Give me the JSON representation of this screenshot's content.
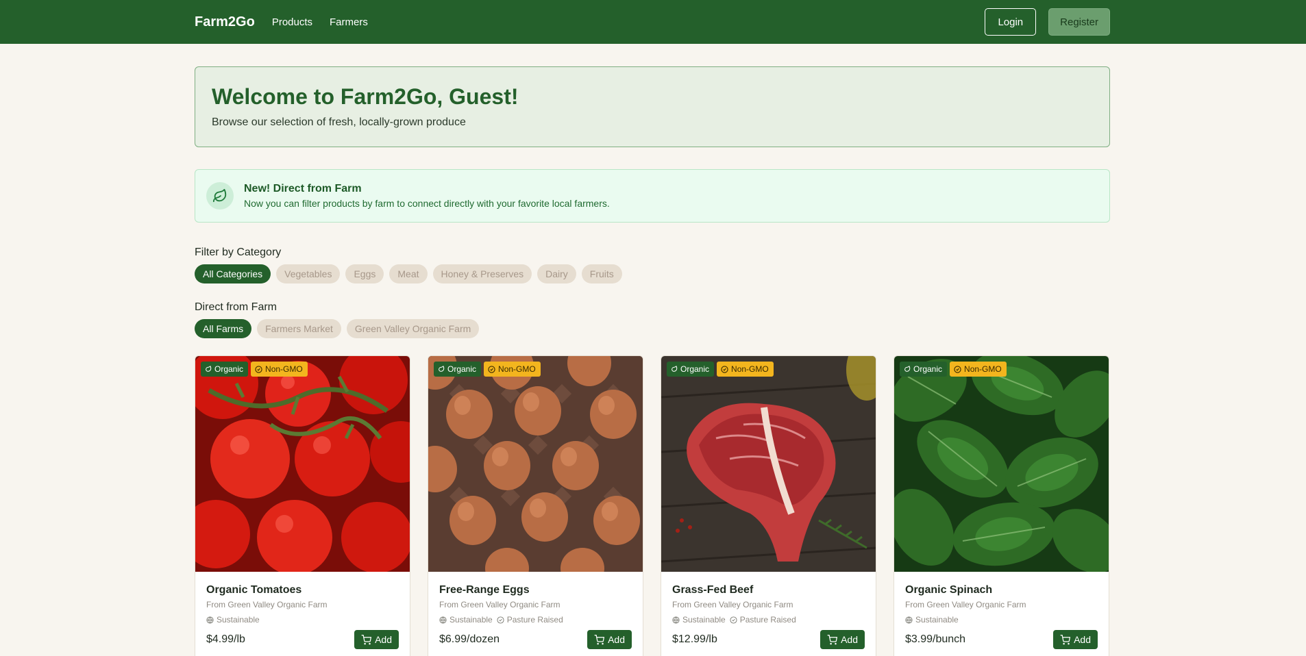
{
  "nav": {
    "brand": "Farm2Go",
    "links": [
      "Products",
      "Farmers"
    ],
    "login": "Login",
    "register": "Register"
  },
  "welcome": {
    "title": "Welcome to Farm2Go, Guest!",
    "subtitle": "Browse our selection of fresh, locally-grown produce"
  },
  "notice": {
    "icon": "leaf-icon",
    "title": "New! Direct from Farm",
    "text": "Now you can filter products by farm to connect directly with your favorite local farmers."
  },
  "category_filter": {
    "title": "Filter by Category",
    "options": [
      "All Categories",
      "Vegetables",
      "Eggs",
      "Meat",
      "Honey & Preserves",
      "Dairy",
      "Fruits"
    ],
    "selected": "All Categories"
  },
  "farm_filter": {
    "title": "Direct from Farm",
    "options": [
      "All Farms",
      "Farmers Market",
      "Green Valley Organic Farm"
    ],
    "selected": "All Farms"
  },
  "colors": {
    "primary": "#24602b",
    "badge_nongmo": "#f3b51e",
    "background": "#f8f5ef"
  },
  "products": [
    {
      "name": "Organic Tomatoes",
      "farm": "From Green Valley Organic Farm",
      "badges": [
        "Organic",
        "Non-GMO"
      ],
      "tags": [
        "Sustainable"
      ],
      "price": "$4.99/lb",
      "add_label": "Add",
      "image": "tomatoes"
    },
    {
      "name": "Free-Range Eggs",
      "farm": "From Green Valley Organic Farm",
      "badges": [
        "Organic",
        "Non-GMO"
      ],
      "tags": [
        "Sustainable",
        "Pasture Raised"
      ],
      "price": "$6.99/dozen",
      "add_label": "Add",
      "image": "eggs"
    },
    {
      "name": "Grass-Fed Beef",
      "farm": "From Green Valley Organic Farm",
      "badges": [
        "Organic",
        "Non-GMO"
      ],
      "tags": [
        "Sustainable",
        "Pasture Raised"
      ],
      "price": "$12.99/lb",
      "add_label": "Add",
      "image": "beef"
    },
    {
      "name": "Organic Spinach",
      "farm": "From Green Valley Organic Farm",
      "badges": [
        "Organic",
        "Non-GMO"
      ],
      "tags": [
        "Sustainable"
      ],
      "price": "$3.99/bunch",
      "add_label": "Add",
      "image": "spinach"
    }
  ]
}
